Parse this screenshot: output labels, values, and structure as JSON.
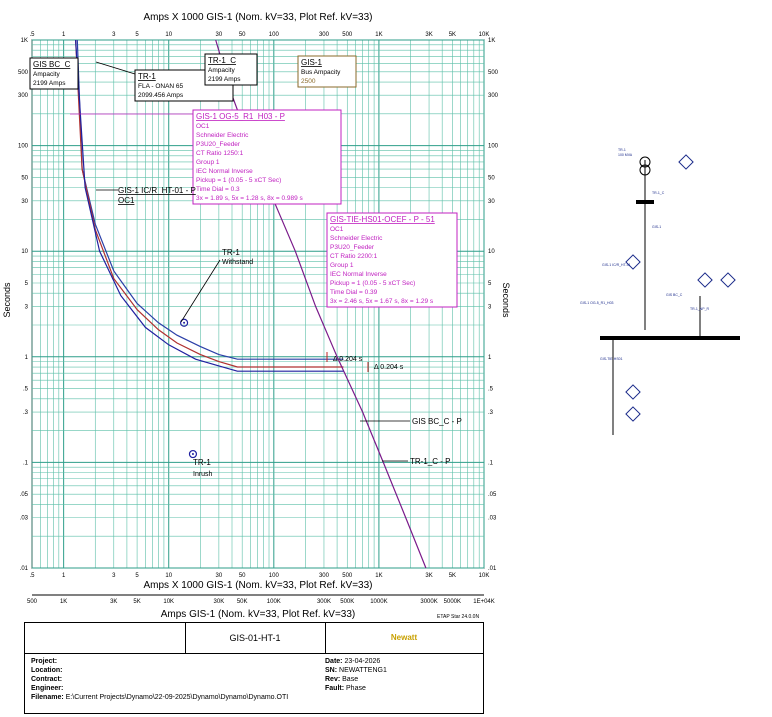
{
  "chart_data": {
    "type": "line",
    "title": "Amps X 1000 GIS-1 (Nom. kV=33, Plot Ref. kV=33)",
    "bottom_title": "Amps X 1000 GIS-1 (Nom. kV=33, Plot Ref. kV=33)",
    "xlabel": "Amps GIS-1 (Nom. kV=33, Plot Ref. kV=33)",
    "ylabel_left": "Seconds",
    "ylabel_right": "Seconds",
    "x_scale": "log",
    "y_scale": "log",
    "xlim": [
      0.5,
      10000
    ],
    "ylim": [
      0.01,
      1000
    ],
    "grid": true,
    "x_ticks": [
      ".5",
      "1",
      "3",
      "5",
      "10",
      "30",
      "50",
      "100",
      "300",
      "500",
      "1K",
      "3K",
      "5K",
      "10K"
    ],
    "x_tick_values": [
      0.5,
      1,
      3,
      5,
      10,
      30,
      50,
      100,
      300,
      500,
      1000,
      3000,
      5000,
      10000
    ],
    "y_ticks": [
      ".01",
      ".03",
      ".05",
      ".1",
      ".3",
      ".5",
      "1",
      "3",
      "5",
      "10",
      "30",
      "50",
      "100",
      "300",
      "500",
      "1K"
    ],
    "y_tick_values": [
      0.01,
      0.03,
      0.05,
      0.1,
      0.3,
      0.5,
      1,
      3,
      5,
      10,
      30,
      50,
      100,
      300,
      500,
      1000
    ],
    "x2_ticks": [
      "500",
      "1K",
      "3K",
      "5K",
      "10K",
      "30K",
      "50K",
      "100K",
      "300K",
      "500K",
      "1000K",
      "3000K",
      "5000K",
      "1E+04K"
    ],
    "series": [
      {
        "name": "GIS-1 OG-5_R1_H03 - P",
        "color": "#2b3fa8",
        "x": [
          1.35,
          1.5,
          2,
          3,
          5,
          8,
          12,
          20,
          30,
          45,
          45,
          460
        ],
        "y": [
          1000,
          60,
          18,
          6.5,
          3.2,
          2.1,
          1.6,
          1.25,
          1.05,
          0.95,
          0.95,
          0.95
        ]
      },
      {
        "name": "GIS-1 IC/R_HT-01 - P",
        "color": "#b03030",
        "x": [
          1.3,
          1.5,
          2,
          3,
          5,
          8,
          12,
          20,
          30,
          45,
          45,
          460
        ],
        "y": [
          1000,
          60,
          16,
          5.5,
          2.8,
          1.8,
          1.35,
          1.05,
          0.9,
          0.8,
          0.8,
          0.8
        ]
      },
      {
        "name": "TR-1 C - P",
        "color": "#7a1a8a",
        "x": [
          28,
          40,
          60,
          100,
          160,
          250,
          400,
          700,
          1100,
          1800,
          2800
        ],
        "y": [
          1000,
          300,
          100,
          30,
          10,
          3,
          1,
          0.3,
          0.1,
          0.03,
          0.01
        ]
      },
      {
        "name": "GIS BC_C - P",
        "color": "#2020a0",
        "x": [
          1.3,
          1.6,
          2.2,
          3.5,
          6,
          10,
          18,
          30,
          45,
          45,
          460
        ],
        "y": [
          1000,
          40,
          10,
          3.8,
          1.9,
          1.3,
          0.95,
          0.82,
          0.73,
          0.73,
          0.73
        ]
      }
    ],
    "markers": [
      {
        "label": "TR-1 Withstand",
        "x": 14,
        "y": 2.1
      },
      {
        "label": "TR-1 Inrush",
        "x": 17,
        "y": 0.12
      }
    ],
    "annotations": [
      {
        "text": "Δ 0.204 s",
        "x": 380,
        "y": 0.95
      },
      {
        "text": "Δ 0.204 s",
        "x": 600,
        "y": 0.75
      }
    ]
  },
  "labels": {
    "gis_bc": [
      "GIS BC_C",
      "Ampacity",
      "2199 Amps"
    ],
    "tr1_fla": [
      "TR-1",
      "FLA - ONAN 65",
      "2099.456 Amps"
    ],
    "tr1_c_amp": [
      "TR-1_C",
      "Ampacity",
      "2199 Amps"
    ],
    "gis1_bus": [
      "GIS-1",
      "Bus Ampacity",
      "2500"
    ],
    "og5": [
      "GIS-1 OG-5_R1_H03 - P",
      "OC1",
      "Schneider Electric",
      "P3U20_Feeder",
      "CT Ratio 1250:1",
      "Group 1",
      "IEC Normal Inverse",
      "Pickup = 1 (0.05 - 5 xCT Sec)",
      "Time Dial = 0.3",
      "3x = 1.89 s, 5x = 1.28 s, 8x = 0.989 s"
    ],
    "icr": [
      "GIS-1 IC/R_HT-01 - P",
      "OC1"
    ],
    "tie": [
      "GIS-TIE-HS01-OCEF - P - 51",
      "OC1",
      "Schneider Electric",
      "P3U20_Feeder",
      "CT Ratio 2200:1",
      "Group 1",
      "IEC Normal Inverse",
      "Pickup = 1 (0.05 - 5 xCT Sec)",
      "Time Dial = 0.39",
      "3x = 2.46 s, 5x = 1.67 s, 8x = 1.29 s"
    ],
    "withstand": [
      "TR-1",
      "Withstand"
    ],
    "inrush": [
      "TR-1",
      "Inrush"
    ],
    "gis_bc_p": "GIS BC_C - P",
    "tr1_c_p": "TR-1_C - P",
    "delta1": "Δ 0.204 s",
    "delta2": "Δ 0.204 s"
  },
  "one_line": {
    "tr_rating": "TR-1\n100 MVA",
    "labels": [
      "TR-1_C",
      "GIS-1",
      "GIS-1 IC/R_HT-01",
      "GIS-1 OG-5_R1_H03",
      "GIS BC_C",
      "GIS-TIE-HS01",
      "TR-1_NP_R"
    ]
  },
  "title_block": {
    "etap": "ETAP Star 24.0.0N",
    "drawing": "GIS-01-HT-1",
    "logo": "Newatt",
    "project": "Project:",
    "location": "Location:",
    "contract": "Contract:",
    "engineer": "Engineer:",
    "filename_label": "Filename:",
    "filename": "E:\\Current Projects\\Dynamo\\22-09-2025\\Dynamo\\Dynamo\\Dynamo.OTI",
    "date_label": "Date:",
    "date": "23-04-2026",
    "sn_label": "SN:",
    "sn": "NEWATTENG1",
    "rev_label": "Rev:",
    "rev": "Base",
    "fault_label": "Fault:",
    "fault": "Phase"
  }
}
